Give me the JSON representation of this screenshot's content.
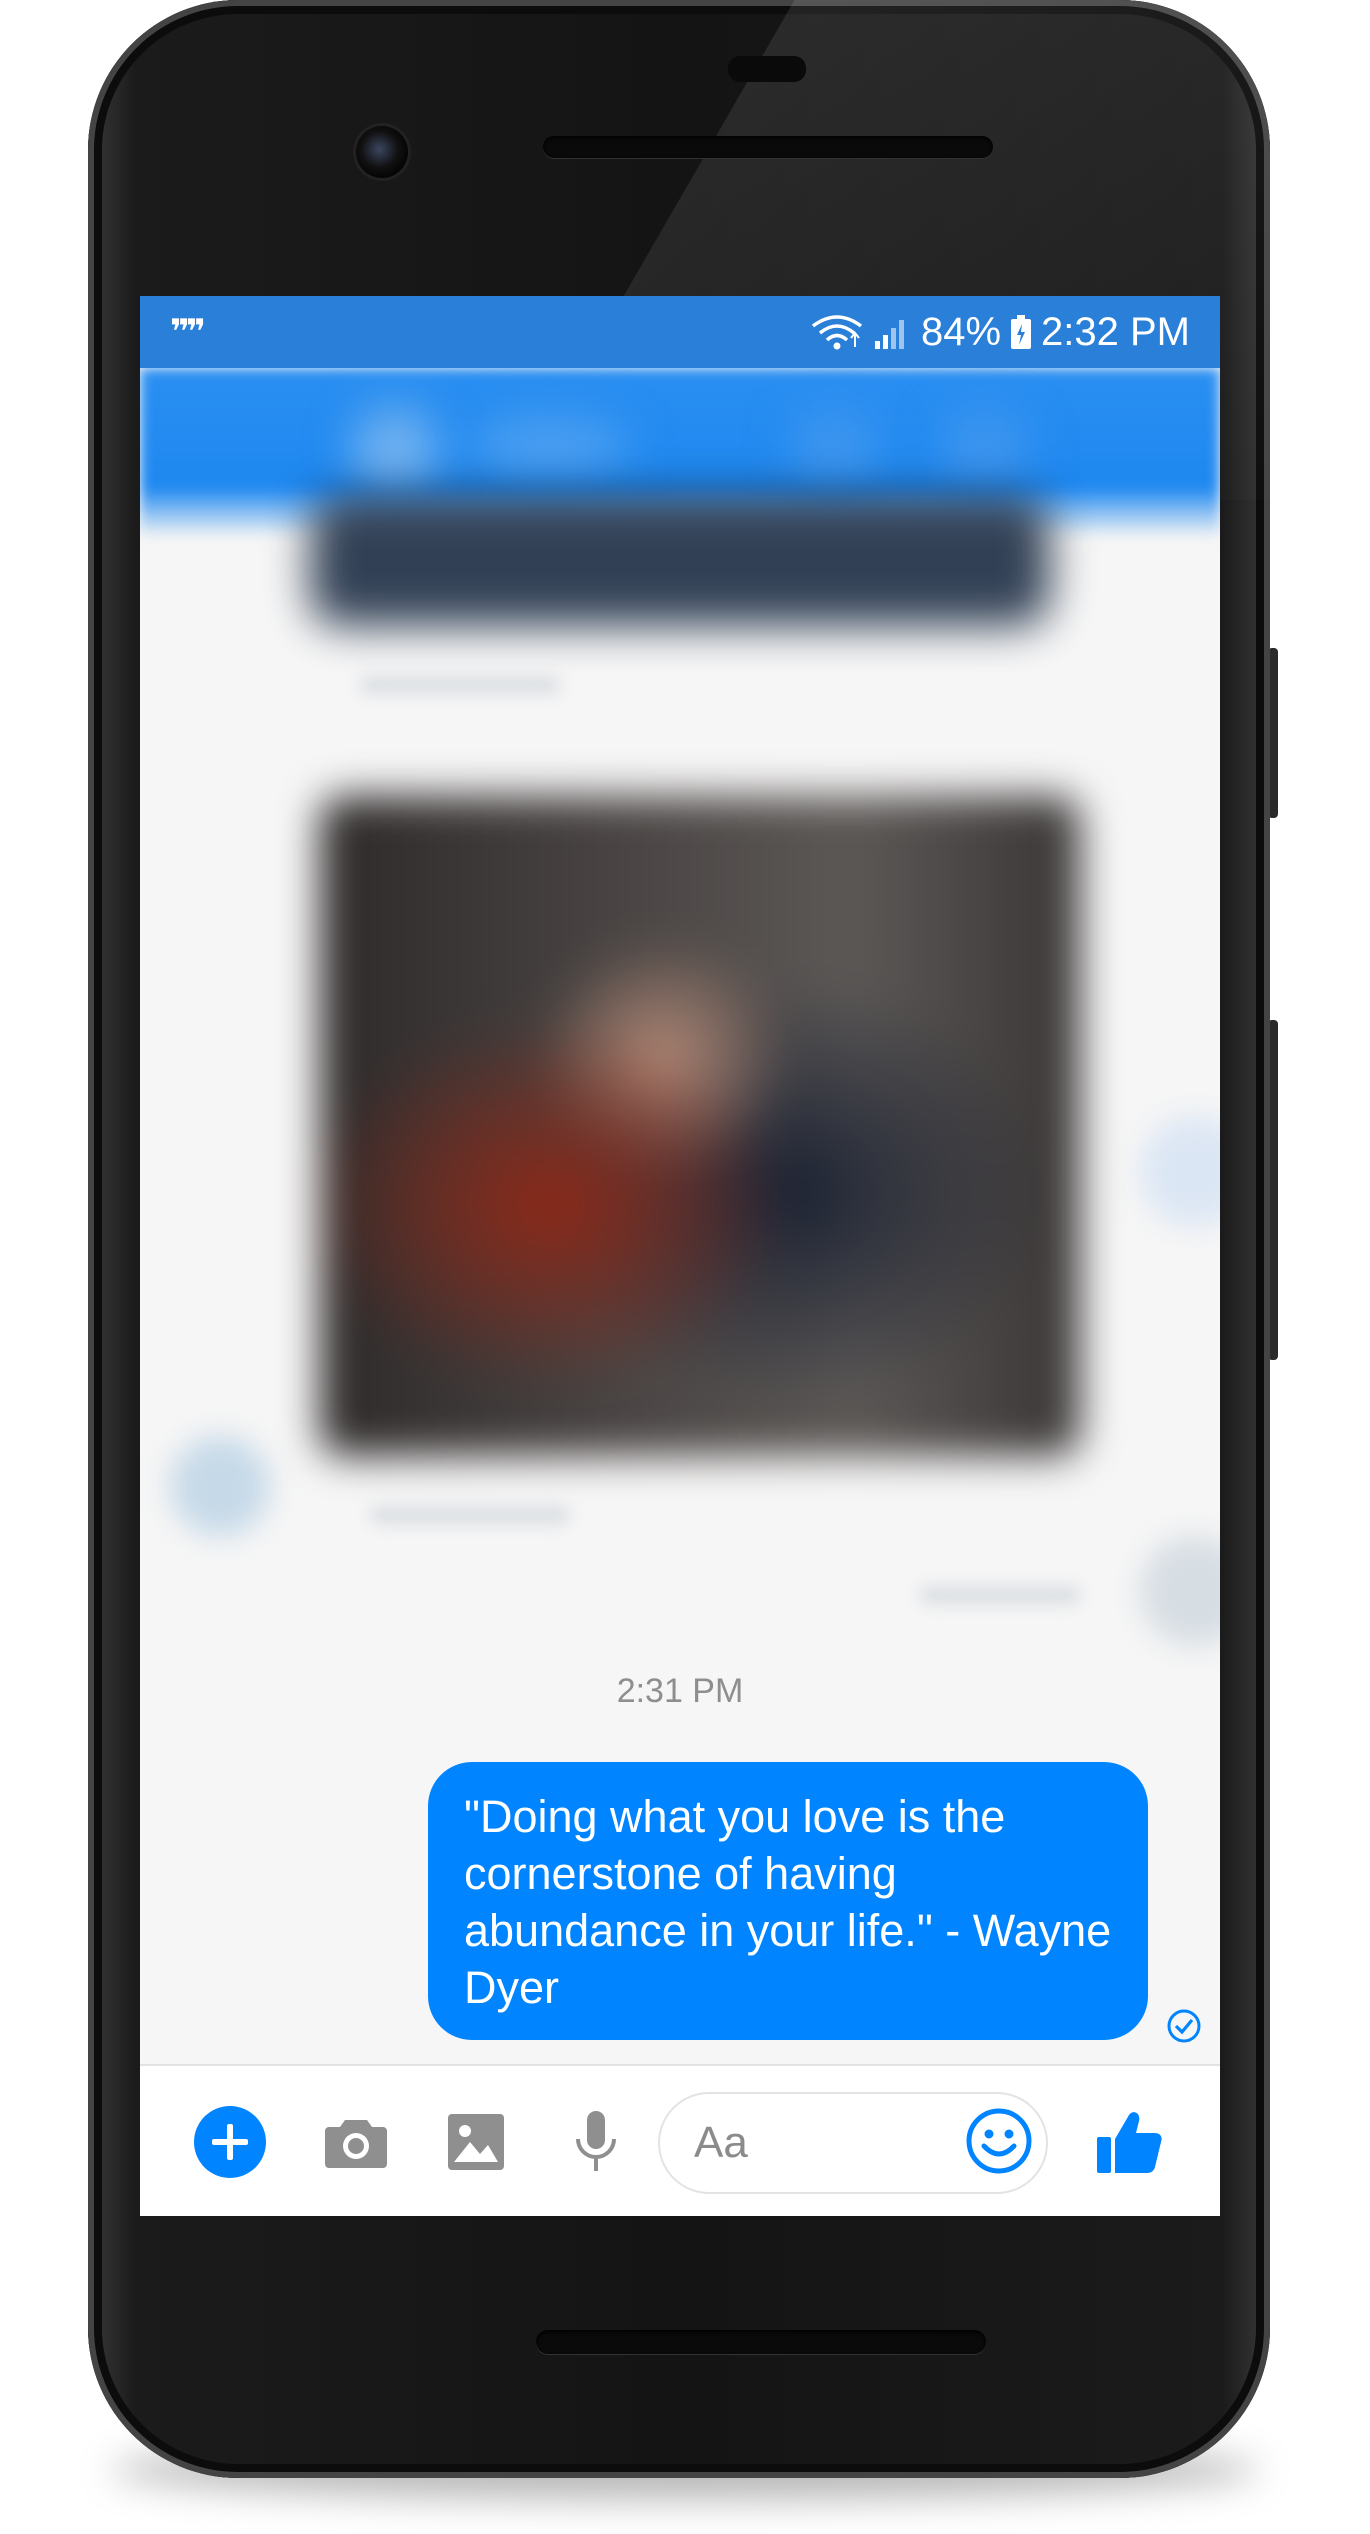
{
  "status_bar": {
    "left_icon": "quote-marks-icon",
    "left_text": "”",
    "battery_percent": "84%",
    "time": "2:32 PM",
    "icons": [
      "wifi-icon",
      "signal-icon",
      "battery-charging-icon"
    ]
  },
  "conversation": {
    "timestamp": "2:31 PM",
    "sent_message": "\"Doing what you love is the cornerstone of having abundance in your life.\" - Wayne Dyer",
    "read_receipt_icon": "sent-check-icon"
  },
  "composer": {
    "placeholder": "Aa",
    "buttons": [
      "plus-icon",
      "camera-icon",
      "gallery-icon",
      "mic-icon",
      "emoji-icon",
      "thumbs-up-icon"
    ]
  },
  "colors": {
    "brand_blue": "#0084ff",
    "status_bar": "#2a7fd9",
    "background": "#f6f6f6"
  }
}
